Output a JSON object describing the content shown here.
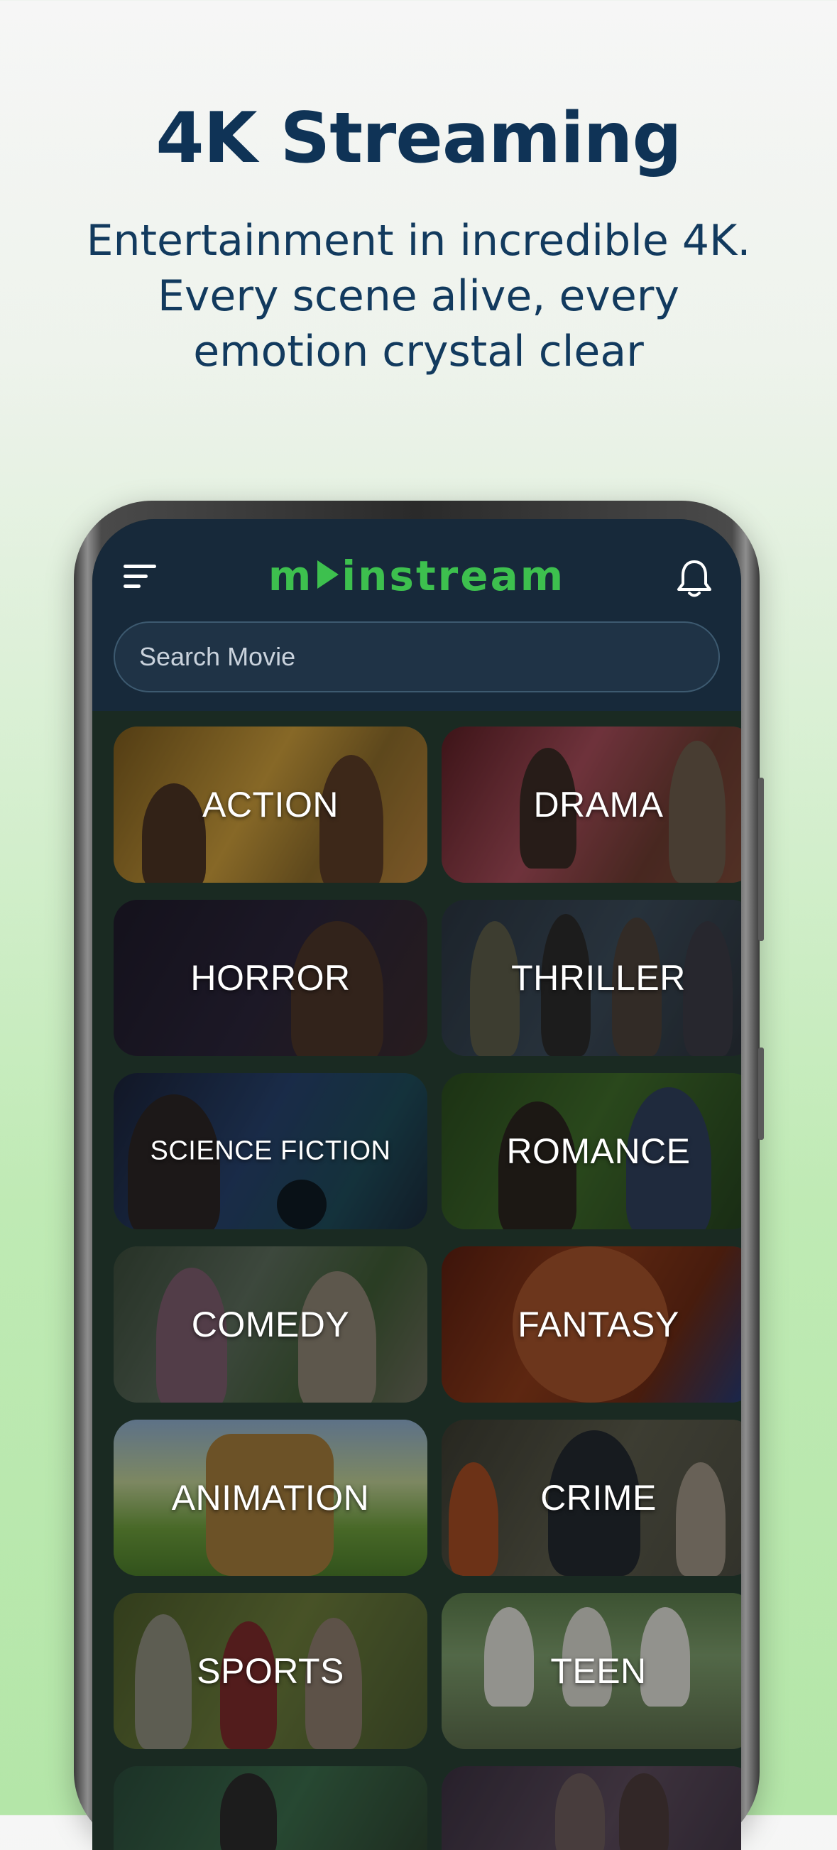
{
  "headline": "4K Streaming",
  "subhead": "Entertainment in incredible 4K. Every scene alive, every emotion crystal clear",
  "app": {
    "logo_left": "m",
    "logo_right": "instream",
    "search_placeholder": "Search Movie",
    "colors": {
      "brand_green": "#3dc04e",
      "app_bar": "#17293a",
      "headline": "#0f3356"
    },
    "icons": [
      "menu-icon",
      "logo-play-icon",
      "bell-icon"
    ]
  },
  "genres": [
    {
      "label": "ACTION"
    },
    {
      "label": "DRAMA"
    },
    {
      "label": "HORROR"
    },
    {
      "label": "THRILLER"
    },
    {
      "label": "SCIENCE FICTION"
    },
    {
      "label": "ROMANCE"
    },
    {
      "label": "COMEDY"
    },
    {
      "label": "FANTASY"
    },
    {
      "label": "ANIMATION"
    },
    {
      "label": "CRIME"
    },
    {
      "label": "SPORTS"
    },
    {
      "label": "TEEN"
    },
    {
      "label": ""
    },
    {
      "label": ""
    }
  ]
}
